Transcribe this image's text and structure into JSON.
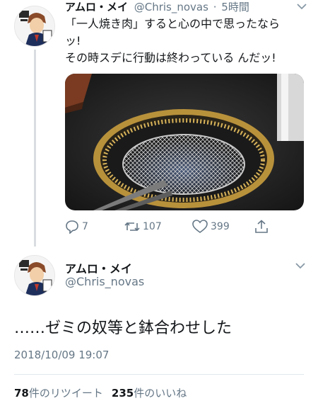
{
  "parent_tweet": {
    "name": "アムロ・メイ",
    "handle": "@Chris_novas",
    "separator": "·",
    "time": "5時間",
    "text_lines": [
      "「一人焼き肉」すると心の中で思ったなら",
      "ッ!",
      "その時スデに行動は終わっている んだッ!"
    ],
    "media_description_icon": "yakiniku-grill-photo",
    "reply_count": "7",
    "retweet_count": "107",
    "like_count": "399"
  },
  "main_tweet": {
    "name": "アムロ・メイ",
    "handle": "@Chris_novas",
    "text": "……ゼミの奴等と鉢合わせした",
    "date": "2018/10/09 19:07",
    "retweets_number": "78",
    "retweets_label": "件のリツイート",
    "likes_number": "235",
    "likes_label": "件のいいね"
  },
  "colors": {
    "text": "#14171a",
    "secondary": "#657786",
    "divider": "#e1e8ed",
    "thread_line": "#d9dde1"
  }
}
